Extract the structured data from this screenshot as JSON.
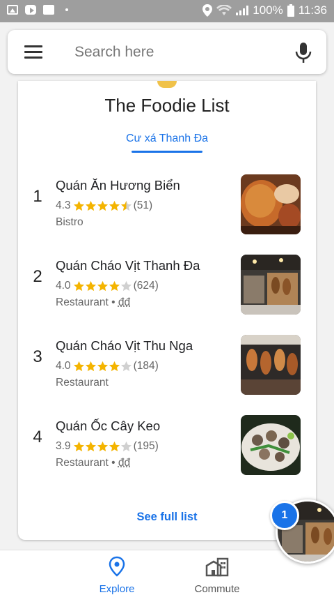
{
  "status_bar": {
    "battery": "100%",
    "time": "11:36"
  },
  "search": {
    "placeholder": "Search here"
  },
  "card": {
    "title": "The Foodie List",
    "area_tab": "Cư xá Thanh Đa",
    "see_full_list": "See full list"
  },
  "places": [
    {
      "rank": "1",
      "name": "Quán Ăn Hương Biển",
      "rating": "4.3",
      "stars": 4.3,
      "reviews": "(51)",
      "type": "Bistro",
      "price": ""
    },
    {
      "rank": "2",
      "name": "Quán Cháo Vịt Thanh Đa",
      "rating": "4.0",
      "stars": 4.0,
      "reviews": "(624)",
      "type": "Restaurant",
      "price": "đđ"
    },
    {
      "rank": "3",
      "name": "Quán Cháo Vịt Thu Nga",
      "rating": "4.0",
      "stars": 4.0,
      "reviews": "(184)",
      "type": "Restaurant",
      "price": ""
    },
    {
      "rank": "4",
      "name": "Quán Ốc Cây Keo",
      "rating": "3.9",
      "stars": 3.9,
      "reviews": "(195)",
      "type": "Restaurant",
      "price": "đđ"
    }
  ],
  "bottom_nav": {
    "explore": "Explore",
    "commute": "Commute"
  },
  "bubble": {
    "badge_count": "1"
  },
  "colors": {
    "accent": "#1a73e8",
    "star": "#f4b400",
    "star_empty": "#d0d0d0"
  }
}
